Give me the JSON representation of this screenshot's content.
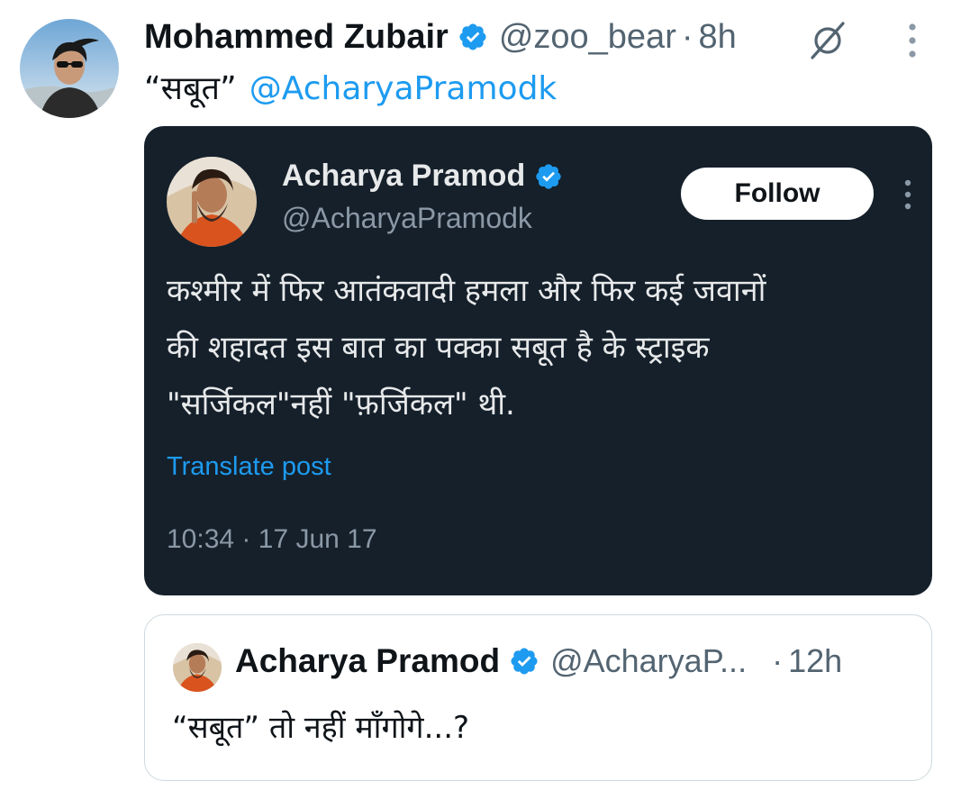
{
  "tweet": {
    "author_name": "Mohammed Zubair",
    "handle": "@zoo_bear",
    "separator": "·",
    "time": "8h",
    "text": "“सबूत”",
    "mention": "@AcharyaPramodk",
    "verified_color": "#1d9bf0"
  },
  "embedded_screenshot": {
    "author_name": "Acharya Pramod",
    "handle": "@AcharyaPramodk",
    "follow_label": "Follow",
    "text_lines": [
      "कश्मीर में फिर आतंकवादी हमला और फिर कई जवानों",
      "की शहादत इस बात का पक्का सबूत है के स्ट्राइक",
      "\"सर्जिकल\"नहीं \"फ़र्जिकल\" थी."
    ],
    "translate_label": "Translate post",
    "timestamp": "10:34 · 17 Jun 17",
    "background": "#15202b"
  },
  "quoted": {
    "author_name": "Acharya Pramod",
    "handle": "@AcharyaP...",
    "separator": "·",
    "time": "12h",
    "text": "“सबूत” तो नहीं माँगोगे...?"
  },
  "icons": [
    "verified-badge-icon",
    "muted-conversation-icon",
    "more-options-icon"
  ]
}
